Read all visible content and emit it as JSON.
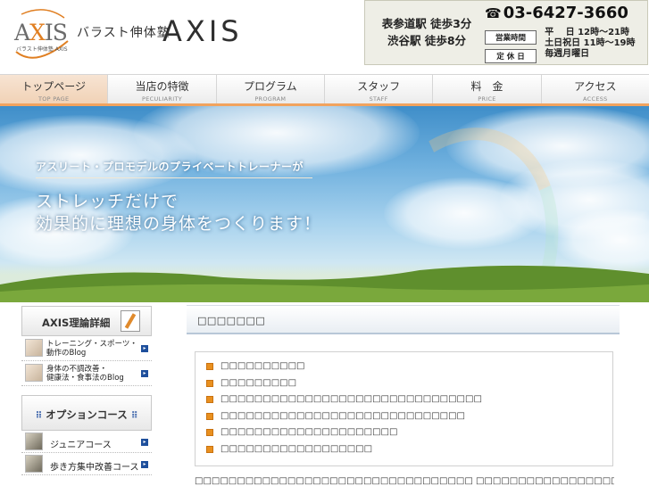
{
  "header": {
    "logo_text": "AXIS",
    "logo_sub": "バラスト伸体塾 AXIS",
    "logo_jp": "バラスト伸体塾",
    "logo_en": "AXIS",
    "station_1": "表参道駅 徒歩3分",
    "station_2": "渋谷駅 徒歩8分",
    "phone": "03-6427-3660",
    "hours_label": "営業時間",
    "hours_1": "平　 日 12時～21時",
    "hours_2": "土日祝日 11時～19時",
    "closed_label": "定 休 日",
    "closed_value": "毎週月曜日"
  },
  "nav": {
    "items": [
      {
        "jp": "トップページ",
        "en": "TOP PAGE"
      },
      {
        "jp": "当店の特徴",
        "en": "PECULIARITY"
      },
      {
        "jp": "プログラム",
        "en": "PROGRAM"
      },
      {
        "jp": "スタッフ",
        "en": "STAFF"
      },
      {
        "jp": "料　金",
        "en": "PRICE"
      },
      {
        "jp": "アクセス",
        "en": "ACCESS"
      }
    ]
  },
  "hero": {
    "tagline_1": "アスリート・プロモデルのプライベートトレーナーが",
    "tagline_2": "ストレッチだけで",
    "tagline_3": "効果的に理想の身体をつくります！"
  },
  "sidebar": {
    "theory_title": "AXIS理論詳細",
    "links": [
      {
        "line1": "トレーニング・スポーツ・",
        "line2": "動作のBlog"
      },
      {
        "line1": "身体の不調改善・",
        "line2": "健康法・食事法のBlog"
      }
    ],
    "option_title": "オプションコース",
    "courses": [
      {
        "label": "ジュニアコース"
      },
      {
        "label": "歩き方集中改善コース"
      }
    ]
  },
  "main": {
    "title": "□□□□□□□",
    "list": [
      "□□□□□□□□□□",
      "□□□□□□□□□",
      "□□□□□□□□□□□□□□□□□□□□□□□□□□□□□□□",
      "□□□□□□□□□□□□□□□□□□□□□□□□□□□□□",
      "□□□□□□□□□□□□□□□□□□□□□",
      "□□□□□□□□□□□□□□□□□□"
    ],
    "body": "□□□□□□□□□□□□□□□□□□□□□□□□□□□□□□□□□ □□□□□□□□□□□□□□□□□□□□□□□□□□□□□□□□□□□□□□□□□□□□"
  },
  "colors": {
    "accent_orange": "#e9901f",
    "nav_underline": "#f2a35e",
    "link_arrow": "#1e4f9c"
  }
}
